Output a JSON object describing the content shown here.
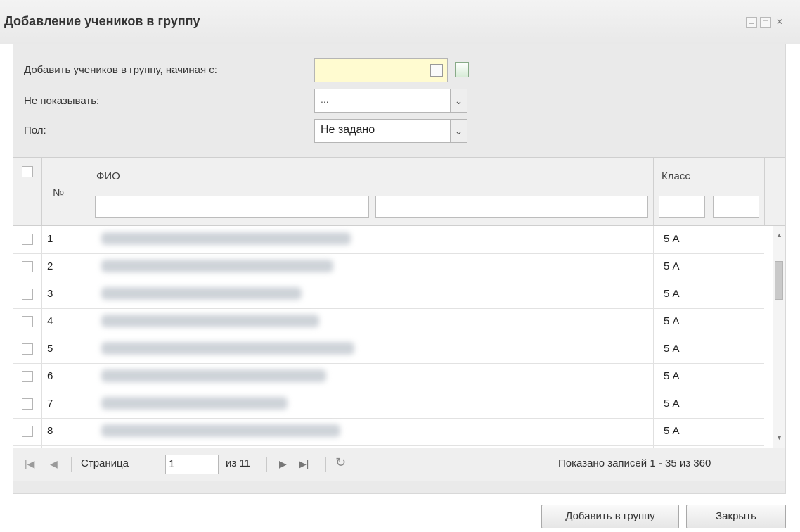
{
  "window": {
    "title": "Добавление учеников в группу",
    "controls": [
      "_",
      "□",
      "X"
    ]
  },
  "form": {
    "start_label": "Добавить учеников в группу, начиная с:",
    "start_value": "",
    "hide_label": "Не показывать:",
    "hide_value": "...",
    "sex_label": "Пол:",
    "sex_value": "Не задано"
  },
  "grid": {
    "headers": {
      "num": "№",
      "fio": "ФИО",
      "klass": "Класс"
    },
    "rows": [
      {
        "num": "1",
        "klass": "5 А"
      },
      {
        "num": "2",
        "klass": "5 А"
      },
      {
        "num": "3",
        "klass": "5 А"
      },
      {
        "num": "4",
        "klass": "5 А"
      },
      {
        "num": "5",
        "klass": "5 А"
      },
      {
        "num": "6",
        "klass": "5 А"
      },
      {
        "num": "7",
        "klass": "5 А"
      },
      {
        "num": "8",
        "klass": "5 А"
      }
    ]
  },
  "pager": {
    "page_label": "Страница",
    "page_value": "1",
    "of_label": "из 11",
    "summary": "Показано записей 1 - 35 из 360"
  },
  "buttons": {
    "add": "Добавить в группу",
    "close": "Закрыть"
  }
}
